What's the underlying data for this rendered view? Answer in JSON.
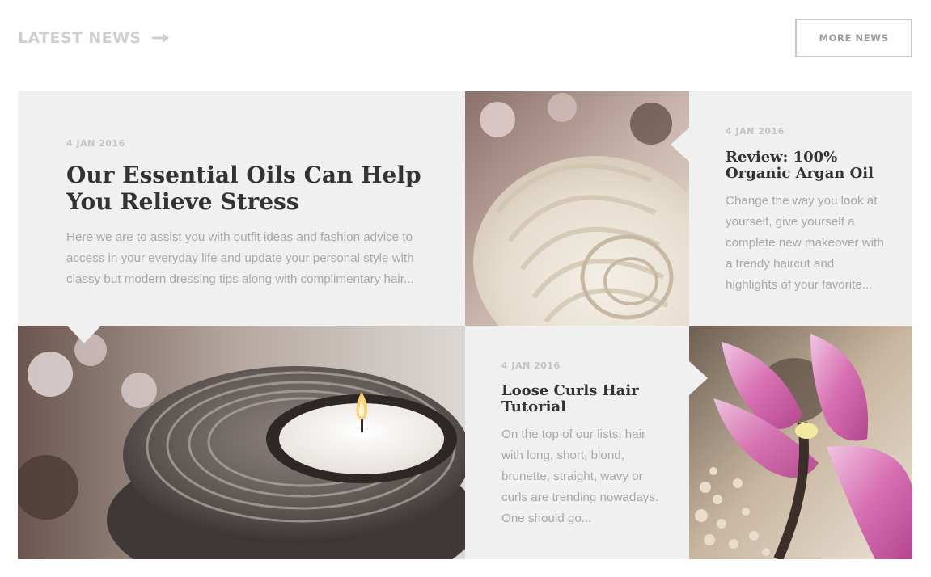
{
  "header": {
    "section_title": "LATEST NEWS",
    "arrow_icon": "arrow-right-icon",
    "more_button": "MORE NEWS"
  },
  "articles": [
    {
      "date": "4 JAN 2016",
      "title": "Our Essential Oils Can Help You Relieve Stress",
      "excerpt": "Here we are to assist you with outfit ideas and fashion advice to access in your everyday life and update your personal style with classy but modern dressing tips along with complimentary hair..."
    },
    {
      "date": "4 JAN 2016",
      "title": "Review: 100% Organic Argan Oil",
      "excerpt": "Change the way you look at yourself, give yourself a complete new makeover with a trendy haircut and highlights of your favorite..."
    },
    {
      "date": "4 JAN 2016",
      "title": "Loose Curls Hair Tutorial",
      "excerpt": "On the top of our lists, hair with long, short, blond, brunette, straight, wavy or curls are trending nowadays. One should go..."
    }
  ],
  "images": {
    "towel": "rolled-towel-photo",
    "candle": "candle-in-wooden-holder-photo",
    "flower": "pink-orchid-photo"
  },
  "colors": {
    "tile_background": "#f0f0f0",
    "headline": "#333333",
    "muted_text": "#a8a8a8",
    "header_text": "#cfcfcf"
  }
}
